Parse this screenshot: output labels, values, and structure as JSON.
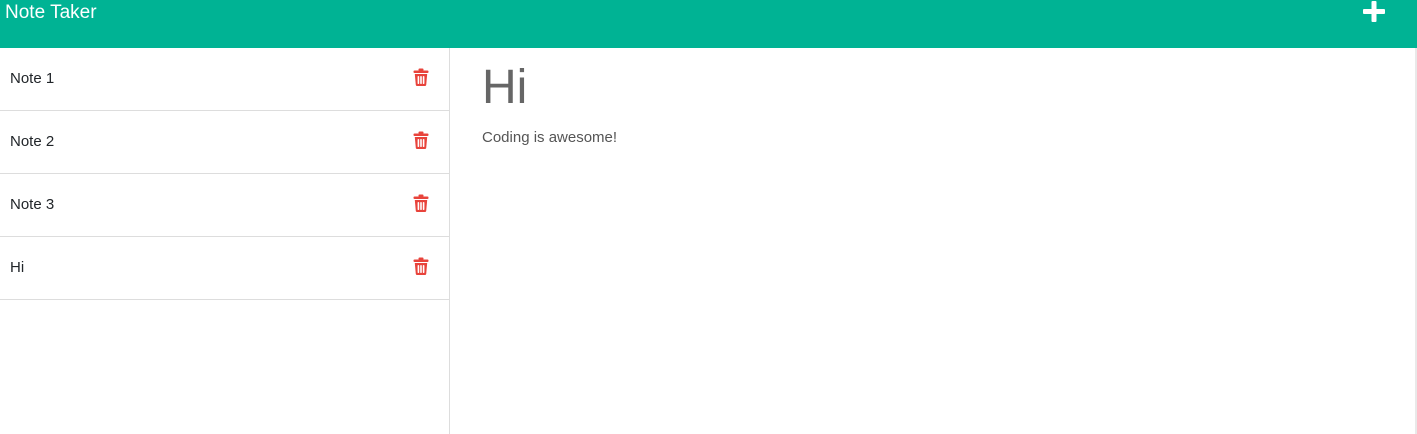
{
  "app": {
    "title": "Note Taker"
  },
  "colors": {
    "navbar": "#00b394",
    "delete_icon": "#e8433b"
  },
  "icons": {
    "new_note": "plus-icon",
    "delete": "trash-icon"
  },
  "notes": [
    {
      "title": "Note 1"
    },
    {
      "title": "Note 2"
    },
    {
      "title": "Note 3"
    },
    {
      "title": "Hi"
    }
  ],
  "active_note": {
    "title": "Hi",
    "text": "Coding is awesome!"
  }
}
